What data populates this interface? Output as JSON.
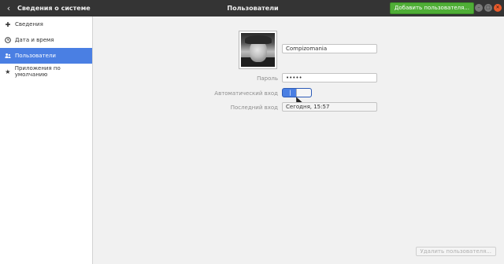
{
  "header": {
    "sidebar_title": "Сведения о системе",
    "main_title": "Пользователи",
    "add_user_label": "Добавить пользователя..."
  },
  "sidebar": {
    "items": [
      {
        "label": "Сведения",
        "icon": "plus-icon"
      },
      {
        "label": "Дата и время",
        "icon": "clock-icon"
      },
      {
        "label": "Пользователи",
        "icon": "users-icon",
        "active": true
      },
      {
        "label": "Приложения по умолчанию",
        "icon": "star-icon"
      }
    ]
  },
  "user": {
    "name": "Compizomania",
    "password_label": "Пароль",
    "password_value": "•••••",
    "autologin_label": "Автоматический вход",
    "autologin_on_symbol": "|",
    "last_login_label": "Последний вход",
    "last_login_value": "Сегодня, 15:57"
  },
  "footer": {
    "remove_user_label": "Удалить пользователя..."
  },
  "colors": {
    "header_bg": "#343434",
    "accent": "#4a7fe3",
    "add_button": "#4fae36",
    "close_button": "#e95b2c"
  }
}
